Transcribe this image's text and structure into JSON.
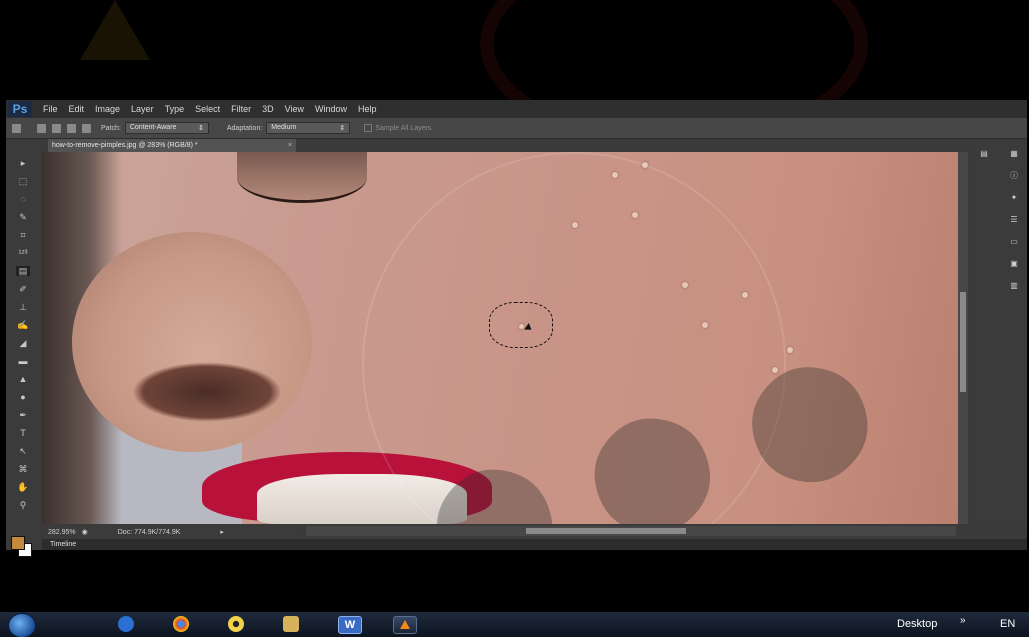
{
  "app": {
    "logo": "Ps",
    "menu": [
      "File",
      "Edit",
      "Image",
      "Layer",
      "Type",
      "Select",
      "Filter",
      "3D",
      "View",
      "Window",
      "Help"
    ]
  },
  "options_bar": {
    "patch_label": "Patch:",
    "patch_value": "Content-Aware",
    "adaptation_label": "Adaptation:",
    "adaptation_value": "Medium",
    "sample_all_layers": "Sample All Layers"
  },
  "document": {
    "tab_title": "how-to-remove-pimples.jpg @ 283% (RGB/8) *",
    "tab_close": "×"
  },
  "status": {
    "zoom": "282.95%",
    "doc_size": "Doc: 774.9K/774.9K"
  },
  "timeline": {
    "label": "Timeline"
  },
  "colors": {
    "foreground": "#c48a3c",
    "background": "#ffffff",
    "lips": "#b8123b"
  },
  "taskbar": {
    "desktop_label": "Desktop",
    "overflow": "»",
    "language": "EN",
    "word_label": "W"
  }
}
